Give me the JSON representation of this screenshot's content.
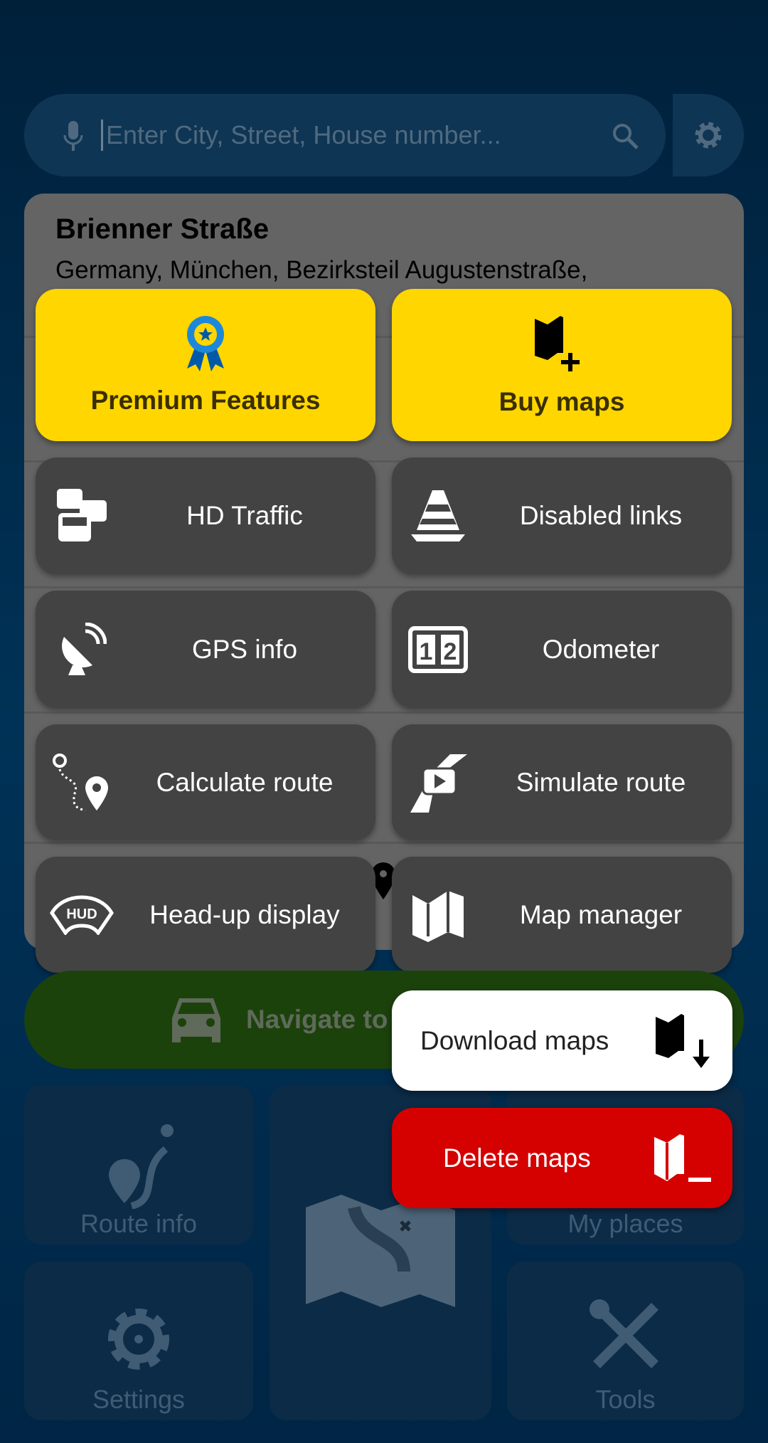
{
  "search": {
    "placeholder": "Enter City, Street, House number..."
  },
  "place": {
    "title": "Brienner Straße",
    "address": "Germany, München, Bezirksteil Augustenstraße,"
  },
  "menu": {
    "premium": "Premium Features",
    "buy_maps": "Buy maps",
    "items": [
      "HD Traffic",
      "Disabled links",
      "GPS info",
      "Odometer",
      "Calculate route",
      "Simulate route",
      "Head-up display",
      "Map manager"
    ]
  },
  "navigate": "Navigate to",
  "popup": {
    "download": "Download maps",
    "delete": "Delete maps"
  },
  "bottom": {
    "route_info": "Route info",
    "my_places": "My places",
    "settings": "Settings",
    "tools": "Tools"
  },
  "colors": {
    "accent_yellow": "#ffd600",
    "delete_red": "#d50000",
    "navigate_green": "#1c420c"
  }
}
